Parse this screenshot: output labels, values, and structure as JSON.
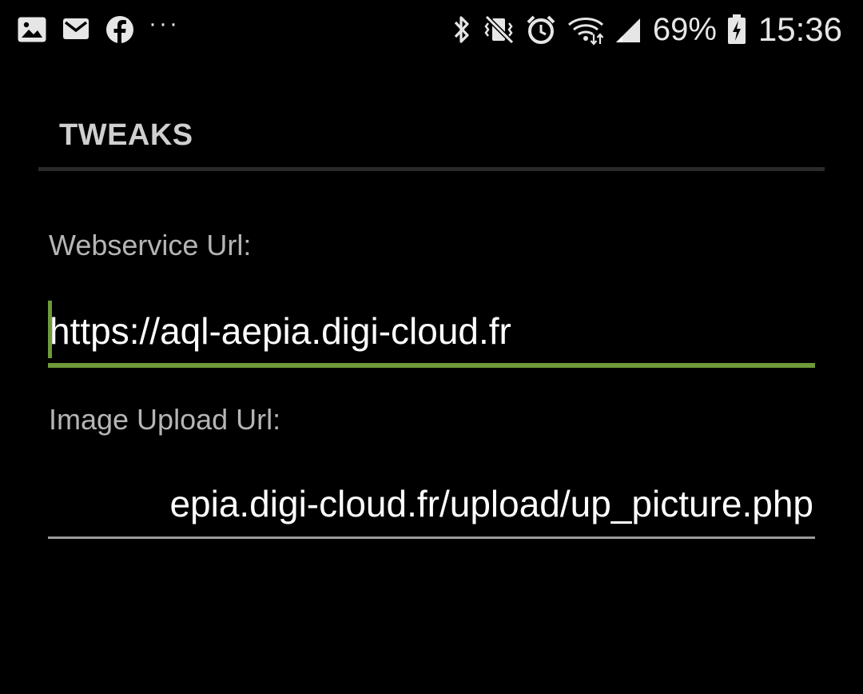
{
  "status_bar": {
    "left_icons": [
      "gallery-icon",
      "email-icon",
      "facebook-icon",
      "more-notifications-icon"
    ],
    "more_label": "···",
    "right_icons": [
      "bluetooth-icon",
      "vibrate-mute-icon",
      "alarm-icon",
      "wifi-icon",
      "cell-signal-icon",
      "battery-icon"
    ],
    "battery_percent": "69%",
    "time": "15:36"
  },
  "section": {
    "title": "TWEAKS"
  },
  "fields": {
    "webservice": {
      "label": "Webservice Url:",
      "value": "https://aql-aepia.digi-cloud.fr",
      "focused": true
    },
    "image_upload": {
      "label": "Image Upload Url:",
      "value": "epia.digi-cloud.fr/upload/up_picture.php",
      "focused": false
    }
  },
  "colors": {
    "background": "#000000",
    "accent": "#6f9a3a",
    "label": "#b5b5b5",
    "header": "#cfcfcf",
    "divider": "#2a2a2a"
  }
}
